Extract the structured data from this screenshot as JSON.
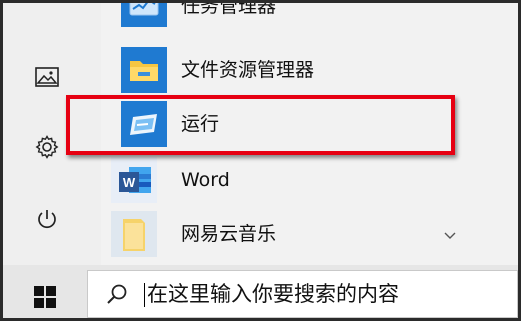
{
  "start_menu": {
    "apps": [
      {
        "label": "任务管理器",
        "icon": "task-manager-icon"
      },
      {
        "label": "文件资源管理器",
        "icon": "folder-icon"
      },
      {
        "label": "运行",
        "icon": "run-icon"
      },
      {
        "label": "Word",
        "icon": "word-icon"
      },
      {
        "label": "网易云音乐",
        "icon": "netease-music-folder-icon"
      }
    ],
    "rail_icons": [
      "pictures-icon",
      "settings-gear-icon",
      "power-icon"
    ]
  },
  "taskbar": {
    "search_placeholder": "在这里输入你要搜索的内容"
  },
  "colors": {
    "highlight_border": "#e60012",
    "tile_blue": "#1f7ad1",
    "word_blue": "#2b5797",
    "folder_yellow": "#f6c642"
  }
}
